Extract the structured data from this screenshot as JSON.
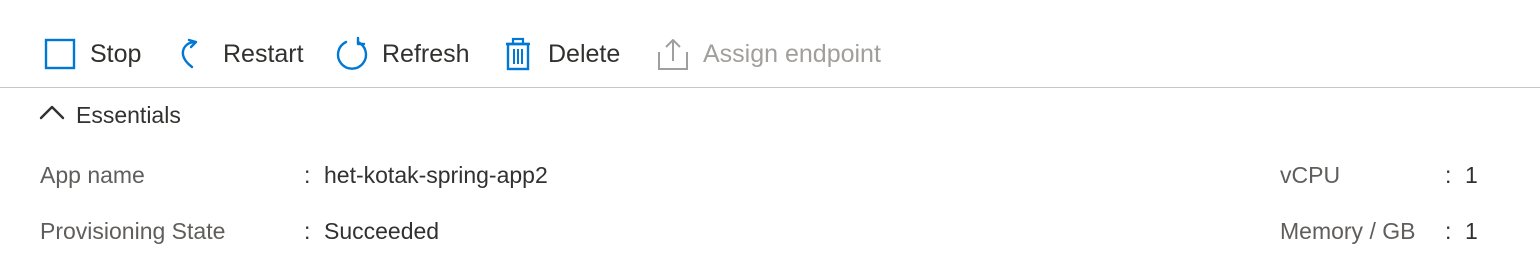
{
  "toolbar": {
    "stop_label": "Stop",
    "restart_label": "Restart",
    "refresh_label": "Refresh",
    "delete_label": "Delete",
    "assign_endpoint_label": "Assign endpoint"
  },
  "essentials": {
    "title": "Essentials",
    "separator": ":",
    "left": [
      {
        "label": "App name",
        "value": "het-kotak-spring-app2"
      },
      {
        "label": "Provisioning State",
        "value": "Succeeded"
      }
    ],
    "right": [
      {
        "label": "vCPU",
        "value": "1"
      },
      {
        "label": "Memory / GB",
        "value": "1"
      }
    ]
  },
  "colors": {
    "accent": "#0078d4",
    "disabled": "#a19f9d",
    "text": "#323130",
    "label": "#605e5c"
  },
  "icons": {
    "stop": "stop-icon",
    "restart": "restart-icon",
    "refresh": "refresh-icon",
    "delete": "delete-icon",
    "assign_endpoint": "upload-icon",
    "collapse": "chevron-up-icon"
  }
}
